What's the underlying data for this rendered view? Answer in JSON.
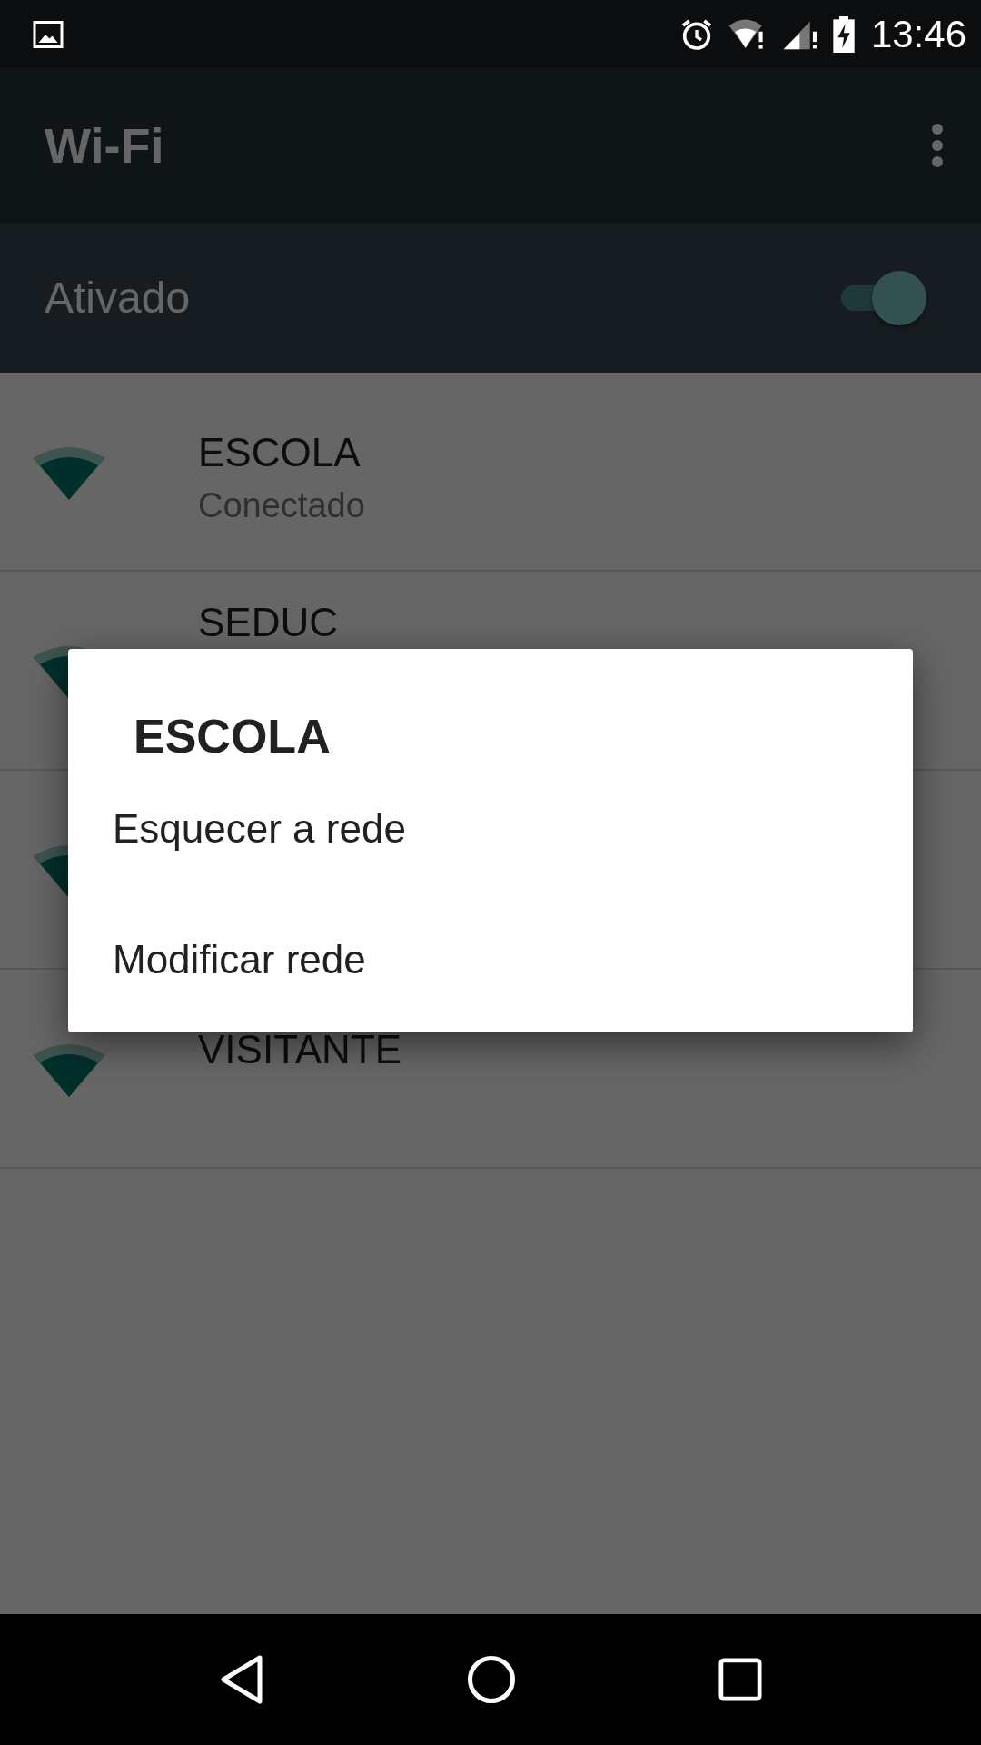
{
  "status_bar": {
    "time": "13:46"
  },
  "app_bar": {
    "title": "Wi-Fi"
  },
  "switch_bar": {
    "label": "Ativado",
    "on": true
  },
  "networks": [
    {
      "kind": "wifi",
      "name": "ESCOLA",
      "status": "Conectado"
    },
    {
      "kind": "wifi",
      "name": "SEDUC"
    },
    {
      "kind": "wifi"
    },
    {
      "kind": "wifi",
      "name": "VISITANTE"
    }
  ],
  "dialog": {
    "title": "ESCOLA",
    "items": [
      "Esquecer a rede",
      "Modificar rede"
    ]
  }
}
